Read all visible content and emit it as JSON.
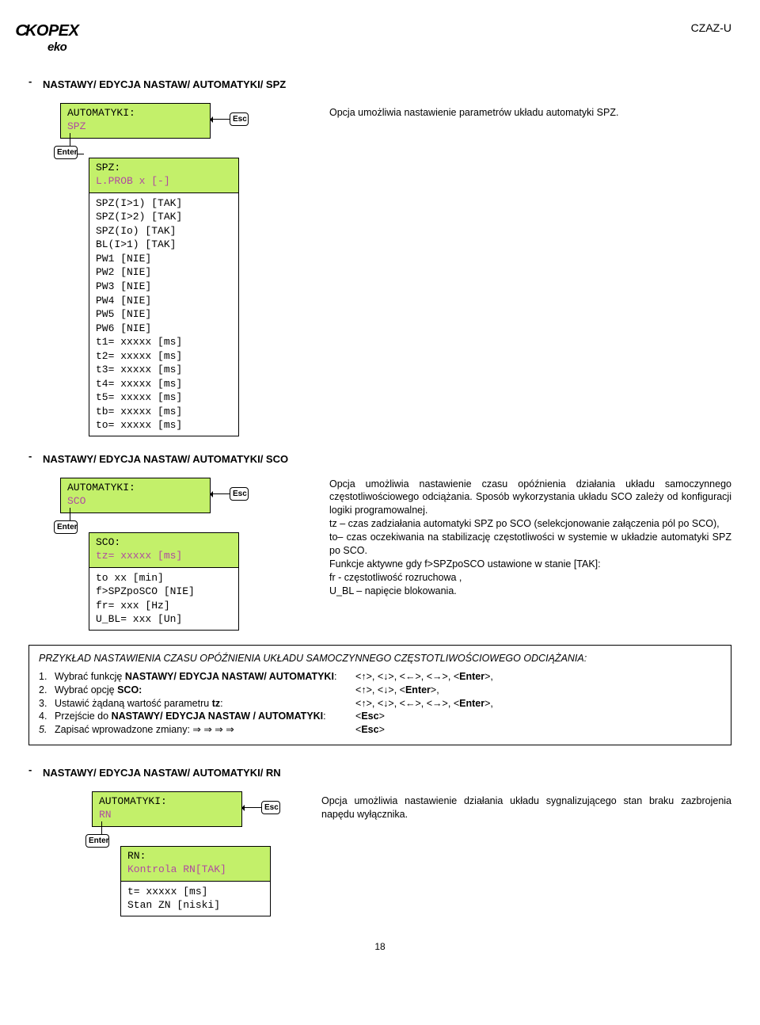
{
  "header": {
    "logo_main": "KOPEX",
    "logo_sub": "eko",
    "model": "CZAZ-U"
  },
  "section_spz": {
    "title": "NASTAWY/ EDYCJA NASTAW/ AUTOMATYKI/ SPZ",
    "menu_line1": "AUTOMATYKI:",
    "menu_line2": "SPZ",
    "esc": "Esc",
    "enter": "Enter",
    "right_text": "Opcja umożliwia nastawienie parametrów układu automatyki SPZ.",
    "sub_line1": "SPZ:",
    "sub_line2": "L.PROB  x  [-]",
    "list": [
      "SPZ(I>1)  [TAK]",
      "SPZ(I>2)  [TAK]",
      "SPZ(Io)   [TAK]",
      "BL(I>1)   [TAK]",
      "PW1       [NIE]",
      "PW2       [NIE]",
      "PW3       [NIE]",
      "PW4       [NIE]",
      "PW5       [NIE]",
      "PW6       [NIE]",
      "t1=  xxxxx [ms]",
      "t2=  xxxxx [ms]",
      "t3=  xxxxx [ms]",
      "t4=  xxxxx [ms]",
      "t5=  xxxxx [ms]",
      "tb=  xxxxx [ms]",
      "to=  xxxxx [ms]"
    ]
  },
  "section_sco": {
    "title": "NASTAWY/ EDYCJA NASTAW/ AUTOMATYKI/ SCO",
    "menu_line1": "AUTOMATYKI:",
    "menu_line2": "SCO",
    "esc": "Esc",
    "enter": "Enter",
    "sub_line1": "SCO:",
    "sub_line2": "tz=  xxxxx  [ms]",
    "list": [
      "to       xx [min]",
      "f>SPZpoSCO  [NIE]",
      "fr=    xxx  [Hz]",
      "U_BL=  xxx  [Un]"
    ],
    "right_p1": "Opcja umożliwia nastawienie czasu opóźnienia działania układu samoczynnego częstotliwościowego odciążania. Sposób wykorzystania układu SCO zależy od konfiguracji logiki programowalnej.",
    "right_p2a": "tz – czas zadziałania automatyki SPZ po SCO (selekcjonowanie załączenia pól po SCO),",
    "right_p2b": "to– czas oczekiwania na stabilizację częstotliwości w systemie w układzie automatyki SPZ po SCO.",
    "right_p3": "Funkcje aktywne gdy f>SPZpoSCO ustawione w  stanie [TAK]:",
    "right_p4": "fr - częstotliwość rozruchowa ,",
    "right_p5": "U_BL – napięcie blokowania."
  },
  "example": {
    "title": "PRZYKŁAD NASTAWIENIA CZASU OPÓŹNIENIA UKŁADU SAMOCZYNNEGO CZĘSTOTLIWOŚCIOWEGO ODCIĄŻANIA:",
    "rows": [
      {
        "n": "1.",
        "label_pre": "Wybrać funkcję ",
        "label_b": "NASTAWY/ EDYCJA NASTAW/ AUTOMATYKI",
        "label_post": ":",
        "keys": "<↑>, <↓>, <←>, <→>, <Enter>,"
      },
      {
        "n": "2.",
        "label_pre": "Wybrać opcję ",
        "label_b": "SCO:",
        "label_post": "",
        "keys": "<↑>, <↓>, <Enter>,"
      },
      {
        "n": "3.",
        "label_pre": "Ustawić żądaną wartość parametru ",
        "label_b": "tz",
        "label_post": ":",
        "keys": "<↑>, <↓>, <←>, <→>, <Enter>,"
      },
      {
        "n": "4.",
        "label_pre": "Przejście do ",
        "label_b": "NASTAWY/ EDYCJA NASTAW / AUTOMATYKI",
        "label_post": ":",
        "keys": "<Esc>"
      },
      {
        "n": "5.",
        "label_pre": "Zapisać wprowadzone zmiany: ⇒    ⇒    ⇒    ⇒",
        "label_b": "",
        "label_post": "",
        "keys": "<Esc>"
      }
    ]
  },
  "section_rn": {
    "title": "NASTAWY/ EDYCJA NASTAW/ AUTOMATYKI/ RN",
    "menu_line1": "AUTOMATYKI:",
    "menu_line2": "RN",
    "esc": "Esc",
    "enter": "Enter",
    "sub_line1": "RN:",
    "sub_line2": "Kontrola RN[TAK]",
    "list": [
      "t=   xxxxx  [ms]",
      "Stan ZN  [niski]"
    ],
    "right_text": "Opcja umożliwia nastawienie działania układu sygnalizującego stan braku zazbrojenia napędu wyłącznika."
  },
  "page_number": "18"
}
